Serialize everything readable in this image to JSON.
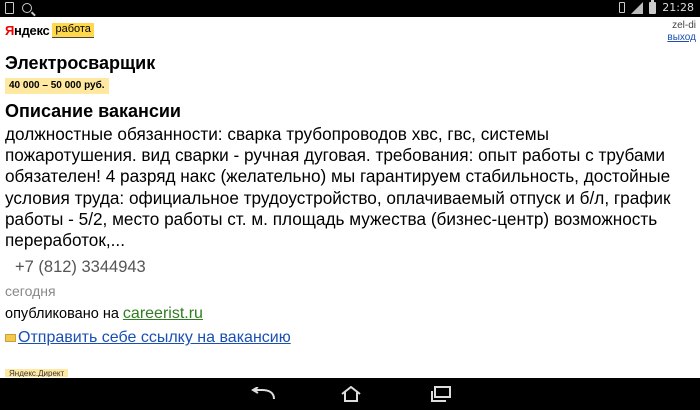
{
  "status_bar": {
    "time": "21:28",
    "icons": [
      "sd-card-icon",
      "search-icon",
      "vibrate-icon",
      "signal-icon",
      "battery-icon"
    ]
  },
  "header": {
    "logo_yandex_first": "Я",
    "logo_yandex_rest": "ндекс",
    "logo_service": "работа",
    "user_name": "zel-di",
    "logout_label": "выход"
  },
  "vacancy": {
    "title": "Электросварщик",
    "salary": "40 000 – 50 000 руб.",
    "description_heading": "Описание вакансии",
    "description": "должностные обязанности: сварка трубопроводов хвс, гвс, системы пожаротушения. вид сварки - ручная дуговая. требования: опыт работы с трубами обязателен! 4 разряд накс (желательно) мы гарантируем стабильность, достойные условия труда: официальное трудоустройство, оплачиваемый отпуск и б/л, график работы - 5/2, место работы ст. м. площадь мужества (бизнес-центр) возможность переработок,...",
    "phone": "+7 (812) 3344943",
    "date": "сегодня",
    "published_prefix": "опубликовано на ",
    "source_site": "careerist.ru",
    "send_link_label": "Отправить себе ссылку на вакансию"
  },
  "ads": {
    "badge": "Яндекс.Директ"
  },
  "colors": {
    "logo_accent": "#ffd84c",
    "salary_bg": "#ffe9a0",
    "link_blue": "#1a4fb3",
    "source_link_green": "#2e7d1f",
    "logo_red": "#ee0000"
  }
}
